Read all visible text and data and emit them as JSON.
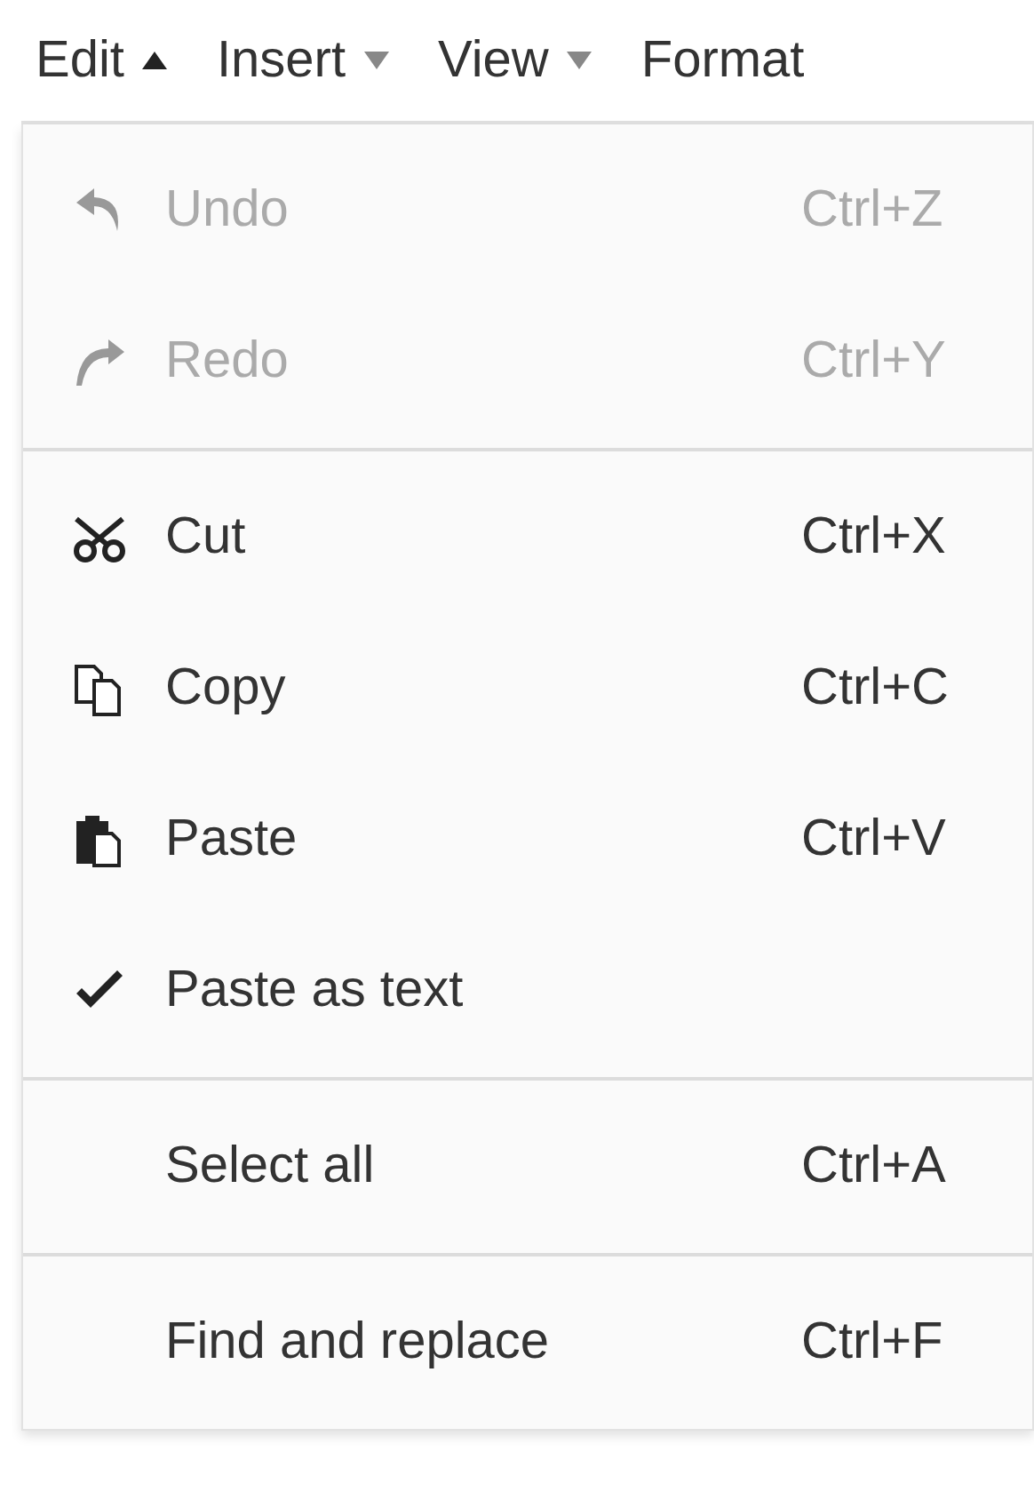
{
  "menubar": [
    {
      "label": "Edit",
      "expanded": true
    },
    {
      "label": "Insert",
      "expanded": false
    },
    {
      "label": "View",
      "expanded": false
    },
    {
      "label": "Format"
    }
  ],
  "menu": {
    "groups": [
      {
        "items": [
          {
            "label": "Undo",
            "shortcut": "Ctrl+Z",
            "kind": "undo",
            "disabled": true
          },
          {
            "label": "Redo",
            "shortcut": "Ctrl+Y",
            "kind": "redo",
            "disabled": true
          }
        ]
      },
      {
        "items": [
          {
            "label": "Cut",
            "shortcut": "Ctrl+X",
            "kind": "cut",
            "disabled": false
          },
          {
            "label": "Copy",
            "shortcut": "Ctrl+C",
            "kind": "copy",
            "disabled": false
          },
          {
            "label": "Paste",
            "shortcut": "Ctrl+V",
            "kind": "paste",
            "disabled": false
          },
          {
            "label": "Paste as text",
            "kind": "toggle",
            "checked": true,
            "disabled": false
          }
        ]
      },
      {
        "items": [
          {
            "label": "Select all",
            "shortcut": "Ctrl+A",
            "disabled": false
          }
        ]
      },
      {
        "items": [
          {
            "label": "Find and replace",
            "shortcut": "Ctrl+F",
            "disabled": false
          }
        ]
      }
    ]
  }
}
